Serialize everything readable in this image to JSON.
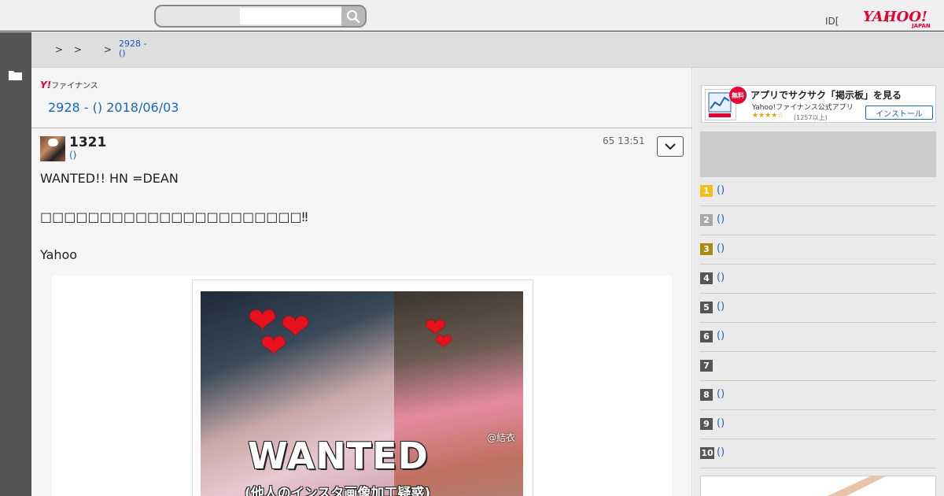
{
  "header": {
    "search_placeholder": "",
    "login_text": "ID[",
    "login_suffix": "]",
    "logo_alt": "YAHOO! JAPAN"
  },
  "breadcrumb": {
    "separators": [
      ">",
      ">",
      ">"
    ],
    "current_line1": "2928 -",
    "current_line2": "()"
  },
  "board": {
    "logo_prefix": "Y!",
    "logo_text": "ファイナンス",
    "title": "2928 - () 2018/06/03"
  },
  "post": {
    "author": "1321",
    "author_sub": "()",
    "time": "65 13:51",
    "lines": [
      "WANTED!! HN =DEAN",
      "",
      "□□□□□□□□□□□□□□□□□□□□□□‼",
      "",
      "Yahoo"
    ],
    "image": {
      "wanted_text": "WANTED",
      "sub_text": "(他人のインスタ画像加工疑惑)",
      "at_tag": "@結衣"
    }
  },
  "sidebar": {
    "app_ad": {
      "badge": "無料",
      "headline": "アプリでサクサク「掲示板」を見る",
      "sub": "Yahoo!ファイナンス公式アプリ",
      "stars": "★★★★☆",
      "rating": "(1257以上)",
      "install": "インストール"
    },
    "ranking": [
      {
        "rank": "1",
        "label": "()",
        "color": "#f0c020"
      },
      {
        "rank": "2",
        "label": "()",
        "color": "#a8a8a8"
      },
      {
        "rank": "3",
        "label": "()",
        "color": "#a88a10"
      },
      {
        "rank": "4",
        "label": "()",
        "color": "#555555"
      },
      {
        "rank": "5",
        "label": "()",
        "color": "#555555"
      },
      {
        "rank": "6",
        "label": "()",
        "color": "#555555"
      },
      {
        "rank": "7",
        "label": "",
        "color": "#555555"
      },
      {
        "rank": "8",
        "label": "()",
        "color": "#555555"
      },
      {
        "rank": "9",
        "label": "()",
        "color": "#555555"
      },
      {
        "rank": "10",
        "label": "()",
        "color": "#555555"
      }
    ]
  },
  "colors": {
    "link": "#1a66b8",
    "brand": "#e60033"
  }
}
